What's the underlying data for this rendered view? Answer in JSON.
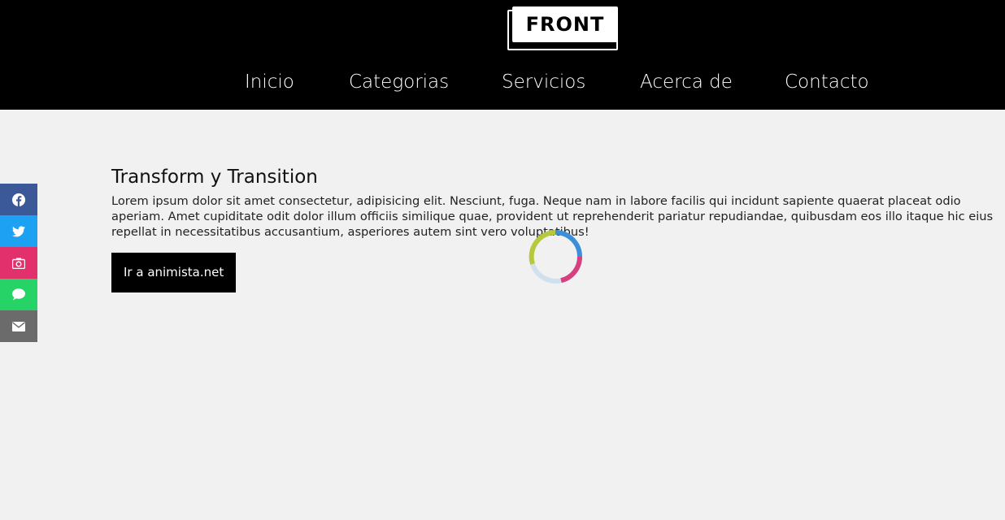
{
  "header": {
    "logo_text": "FRONT",
    "nav": [
      {
        "label": "Inicio"
      },
      {
        "label": "Categorias"
      },
      {
        "label": "Servicios"
      },
      {
        "label": "Acerca de"
      },
      {
        "label": "Contacto"
      }
    ]
  },
  "social": [
    {
      "icon": "facebook-icon",
      "color": "#3b5998"
    },
    {
      "icon": "twitter-icon",
      "color": "#1da1f2"
    },
    {
      "icon": "camera-icon",
      "color": "#e1306c"
    },
    {
      "icon": "chat-icon",
      "color": "#25d366"
    },
    {
      "icon": "envelope-icon",
      "color": "#6b6b6b"
    }
  ],
  "main": {
    "title": "Transform y Transition",
    "paragraph": "Lorem ipsum dolor sit amet consectetur, adipisicing elit. Nesciunt, fuga. Neque nam in labore facilis qui incidunt sapiente quaerat placeat odio aperiam. Amet cupiditate odit dolor illum officiis similique quae, provident ut reprehenderit pariatur repudiandae, quibusdam eos illo itaque hic eius repellat in necessitatibus accusantium, asperiores autem sint vero voluptatibus!",
    "button_label": "Ir a animista.net"
  },
  "spinner": {
    "colors": [
      "#3b8fd9",
      "#d6407f",
      "#d0e0ee",
      "#b6c93c"
    ]
  }
}
